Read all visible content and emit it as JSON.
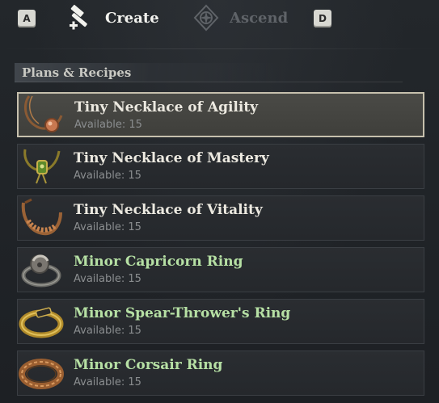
{
  "topbar": {
    "key_left": "A",
    "key_right": "D",
    "tabs": [
      {
        "label": "Create",
        "icon": "hammer-icon",
        "active": true
      },
      {
        "label": "Ascend",
        "icon": "ascend-icon",
        "active": false
      }
    ]
  },
  "section": {
    "title": "Plans & Recipes"
  },
  "items": [
    {
      "name": "Tiny Necklace of Agility",
      "available": "Available: 15",
      "rarity_color": "#ece9e0",
      "selected": true
    },
    {
      "name": "Tiny Necklace of Mastery",
      "available": "Available: 15",
      "rarity_color": "#ece9e0",
      "selected": false
    },
    {
      "name": "Tiny Necklace of Vitality",
      "available": "Available: 15",
      "rarity_color": "#ece9e0",
      "selected": false
    },
    {
      "name": "Minor Capricorn Ring",
      "available": "Available: 15",
      "rarity_color": "#b6e0a4",
      "selected": false
    },
    {
      "name": "Minor Spear-Thrower's Ring",
      "available": "Available: 15",
      "rarity_color": "#b6e0a4",
      "selected": false
    },
    {
      "name": "Minor Corsair Ring",
      "available": "Available: 15",
      "rarity_color": "#b6e0a4",
      "selected": false
    }
  ]
}
